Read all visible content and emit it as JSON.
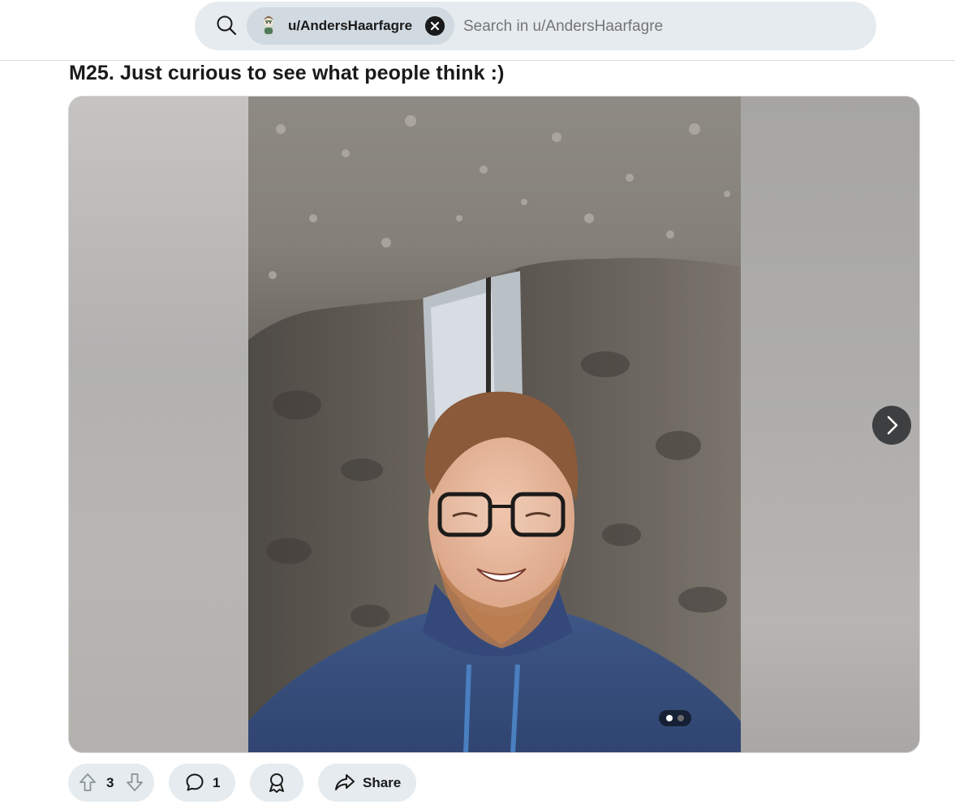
{
  "search": {
    "scope_chip_label": "u/AndersHaarfagre",
    "placeholder": "Search in u/AndersHaarfagre"
  },
  "post": {
    "title": "M25. Just curious to see what people think :)",
    "gallery": {
      "current_image": 1,
      "image_count": 2
    },
    "actions": {
      "vote_count": "3",
      "comment_count": "1",
      "share_label": "Share"
    }
  },
  "icons": {
    "search": "search-icon",
    "avatar": "snoo-avatar-icon",
    "close": "close-icon",
    "next": "chevron-right-icon",
    "upvote": "upvote-arrow-icon",
    "downvote": "downvote-arrow-icon",
    "comment": "comment-bubble-icon",
    "award": "award-ribbon-icon",
    "share": "share-arrow-icon"
  },
  "colors": {
    "pill_background": "#e5ebee",
    "chip_background": "#d0dae0",
    "text": "#1a1a1b",
    "placeholder": "#576f76",
    "nav_button": "#3e3f40"
  }
}
